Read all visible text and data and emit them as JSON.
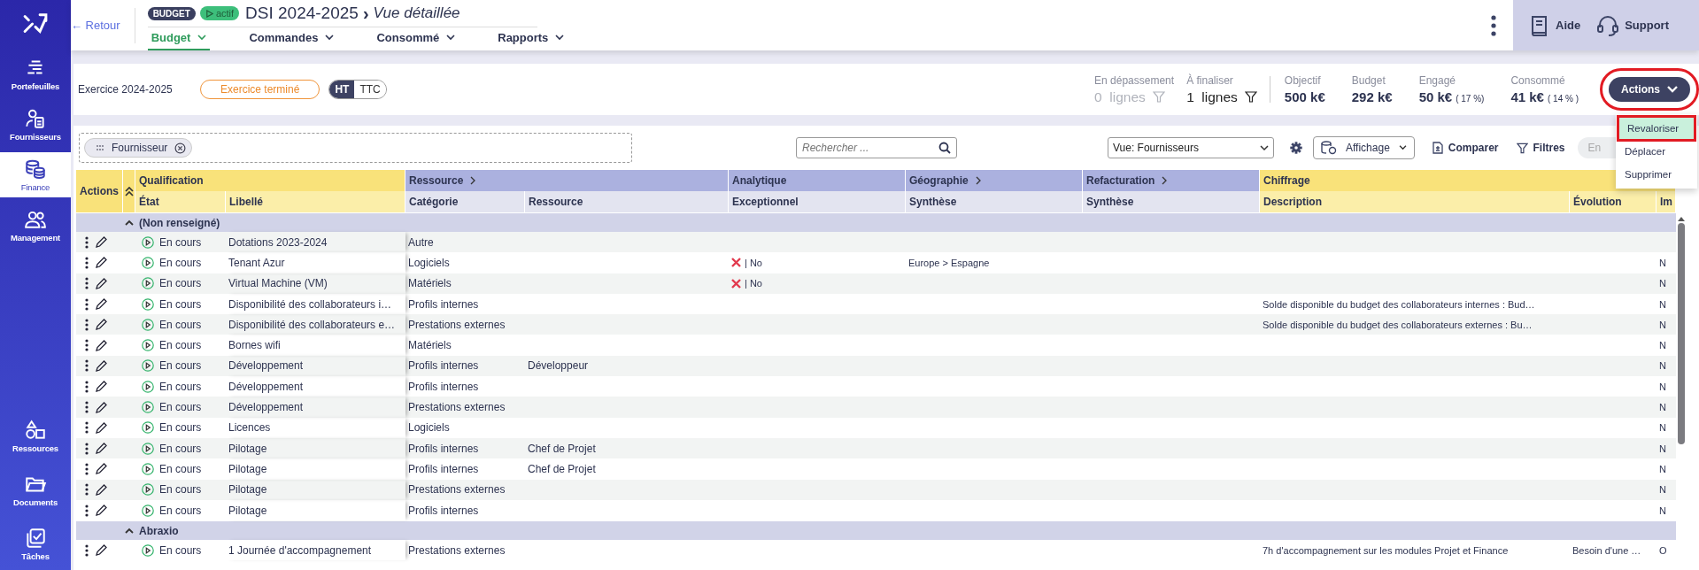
{
  "sidebar": {
    "items": [
      {
        "label": "Portefeuilles",
        "selected": false
      },
      {
        "label": "Fournisseurs",
        "selected": false
      },
      {
        "label": "Finance",
        "selected": true
      },
      {
        "label": "Management",
        "selected": false
      },
      {
        "label": "Ressources",
        "selected": false
      },
      {
        "label": "Documents",
        "selected": false
      },
      {
        "label": "Tâches",
        "selected": false
      }
    ]
  },
  "header": {
    "back": "← Retour",
    "badge": "BUDGET",
    "status": "actif",
    "title": "DSI 2024-2025",
    "separator": "›",
    "subtitle": "Vue détaillée",
    "tabs": [
      {
        "label": "Budget",
        "selected": true
      },
      {
        "label": "Commandes",
        "selected": false
      },
      {
        "label": "Consommé",
        "selected": false
      },
      {
        "label": "Rapports",
        "selected": false
      }
    ],
    "help": "Aide",
    "support": "Support"
  },
  "summary": {
    "exercise": "Exercice 2024-2025",
    "state": "Exercice terminé",
    "tax_toggle": [
      {
        "label": "HT",
        "selected": true
      },
      {
        "label": "TTC",
        "selected": false
      }
    ],
    "counters": [
      {
        "label": "En dépassement",
        "count": "0",
        "unit": "lignes",
        "disabled": true
      },
      {
        "label": "À finaliser",
        "count": "1",
        "unit": "lignes",
        "disabled": false
      }
    ],
    "stats": [
      {
        "label": "Objectif",
        "value": "500 k€"
      },
      {
        "label": "Budget",
        "value": "292 k€"
      },
      {
        "label": "Engagé",
        "value": "50 k€",
        "share": "( 17 %)"
      },
      {
        "label": "Consommé",
        "value": "41 k€",
        "share": "( 14 % )"
      }
    ],
    "actions": {
      "label": "Actions",
      "expanded": true,
      "highlighted": true,
      "menu": [
        {
          "label": "Revaloriser",
          "selected": true
        },
        {
          "label": "Déplacer",
          "selected": false
        },
        {
          "label": "Supprimer",
          "selected": false
        }
      ]
    }
  },
  "toolbar": {
    "group_chip": "Fournisseur",
    "search": {
      "placeholder": "Rechercher ..."
    },
    "view": "Vue: Fournisseurs",
    "display": "Affichage",
    "compare": "Comparer",
    "filters": "Filtres",
    "extra": "En"
  },
  "table": {
    "actions_header": "Actions",
    "column_groups": [
      {
        "label": "Qualification",
        "color": "#f9e27a",
        "expandable": false,
        "columns": [
          "État",
          "Libellé"
        ]
      },
      {
        "label": "Ressource",
        "color": "#abb1df",
        "expandable": true,
        "columns": [
          "Catégorie",
          "Ressource"
        ]
      },
      {
        "label": "Analytique",
        "color": "#abb1df",
        "expandable": false,
        "columns": [
          "Exceptionnel"
        ]
      },
      {
        "label": "Géographie",
        "color": "#abb1df",
        "expandable": true,
        "columns": [
          "Synthèse"
        ]
      },
      {
        "label": "Refacturation",
        "color": "#abb1df",
        "expandable": true,
        "columns": [
          "Synthèse"
        ]
      },
      {
        "label": "Chiffrage",
        "color": "#f9e27a",
        "expandable": false,
        "columns": [
          "Description",
          "Évolution",
          "Im"
        ]
      }
    ],
    "rows": [
      {
        "kind": "group",
        "label": "(Non renseigné)",
        "expanded": true
      },
      {
        "kind": "line",
        "etat": "En cours",
        "libelle": "Dotations 2023-2024",
        "categorie": "Autre"
      },
      {
        "kind": "line",
        "etat": "En cours",
        "libelle": "Tenant Azur",
        "categorie": "Logiciels",
        "exceptionnel": "| No",
        "geographie": "Europe > Espagne",
        "column_12": "N"
      },
      {
        "kind": "line",
        "etat": "En cours",
        "libelle": "Virtual Machine (VM)",
        "categorie": "Matériels",
        "exceptionnel": "| No",
        "column_12": "N"
      },
      {
        "kind": "line",
        "etat": "En cours",
        "libelle": "Disponibilité des collaborateurs i…",
        "categorie": "Profils internes",
        "description": "Solde disponible du budget des collaborateurs internes : Bud…",
        "column_12": "N"
      },
      {
        "kind": "line",
        "etat": "En cours",
        "libelle": "Disponibilité des collaborateurs e…",
        "categorie": "Prestations externes",
        "description": "Solde disponible du budget des collaborateurs externes : Bu…",
        "column_12": "N"
      },
      {
        "kind": "line",
        "etat": "En cours",
        "libelle": "Bornes wifi",
        "categorie": "Matériels",
        "column_12": "N"
      },
      {
        "kind": "line",
        "etat": "En cours",
        "libelle": "Développement",
        "categorie": "Profils internes",
        "ressource": "Développeur",
        "column_12": "N"
      },
      {
        "kind": "line",
        "etat": "En cours",
        "libelle": "Développement",
        "categorie": "Profils internes",
        "column_12": "N"
      },
      {
        "kind": "line",
        "etat": "En cours",
        "libelle": "Développement",
        "categorie": "Prestations externes",
        "column_12": "N"
      },
      {
        "kind": "line",
        "etat": "En cours",
        "libelle": "Licences",
        "categorie": "Logiciels",
        "column_12": "N"
      },
      {
        "kind": "line",
        "etat": "En cours",
        "libelle": "Pilotage",
        "categorie": "Profils internes",
        "ressource": "Chef de Projet",
        "column_12": "N"
      },
      {
        "kind": "line",
        "etat": "En cours",
        "libelle": "Pilotage",
        "categorie": "Profils internes",
        "ressource": "Chef de Projet",
        "column_12": "N"
      },
      {
        "kind": "line",
        "etat": "En cours",
        "libelle": "Pilotage",
        "categorie": "Prestations externes",
        "column_12": "N"
      },
      {
        "kind": "line",
        "etat": "En cours",
        "libelle": "Pilotage",
        "categorie": "Profils internes",
        "column_12": "N"
      },
      {
        "kind": "group",
        "label": "Abraxio",
        "expanded": true
      },
      {
        "kind": "line",
        "etat": "En cours",
        "libelle": "1 Journée d'accompagnement",
        "categorie": "Prestations externes",
        "description": "7h d'accompagnement sur les modules Projet et Finance",
        "evolution": "Besoin d'une …",
        "column_12": "O"
      }
    ]
  }
}
